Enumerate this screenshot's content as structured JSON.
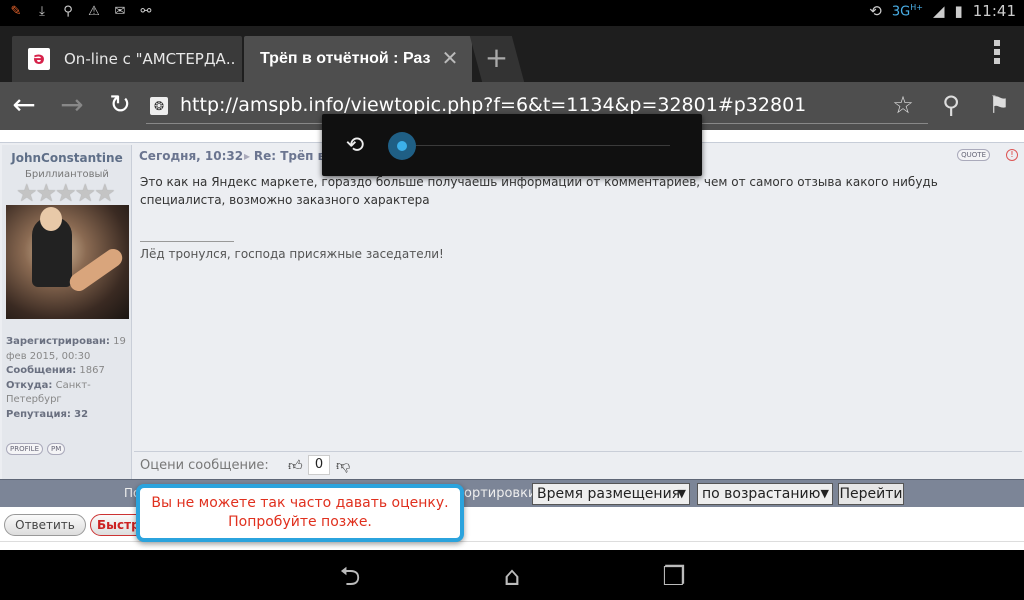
{
  "statusbar": {
    "time": "11:41",
    "network": "3G",
    "network_sup": "H+",
    "left_icons": [
      "app-notification-icon",
      "download-icon",
      "search-icon",
      "warning-icon",
      "message-icon",
      "usb-icon"
    ],
    "right_icons": [
      "rotation-icon",
      "signal-icon",
      "battery-icon"
    ]
  },
  "tabs": [
    {
      "title": "On-line с \"АМСТЕРДА...",
      "active": false,
      "favicon": "ə"
    },
    {
      "title": "Трёп в отчётной : Раз...",
      "active": true
    }
  ],
  "urlbar": {
    "url": "http://amspb.info/viewtopic.php?f=6&t=1134&p=32801#p32801"
  },
  "post": {
    "author": "JohnConstantine",
    "rank": "Бриллиантовый",
    "stars": "★★★★★",
    "registered_label": "Зарегистрирован:",
    "registered_value": "19 фев 2015, 00:30",
    "messages_label": "Сообщения:",
    "messages_value": "1867",
    "from_label": "Откуда:",
    "from_value": "Санкт-Петербург",
    "reputation_label": "Репутация:",
    "reputation_value": "32",
    "profile_btn": "PROFILE",
    "pm_btn": "PM",
    "date": "Сегодня, 10:32",
    "subject": "Re: Трёп в",
    "quote_btn": "QUOTE",
    "body": "Это как на Яндекс маркете, гораздо больше получаешь информации от комментариев, чем от самого отзыва какого нибудь специалиста, возможно заказного характера",
    "signature": "Лёд тронулся, господа присяжные заседатели!",
    "rate_label": "Оцени сообщение:",
    "rate_value": "0"
  },
  "sortbar": {
    "left_text": "По",
    "label": "ортировки",
    "field_value": "Время размещения",
    "dir_value": "по возрастанию",
    "go_label": "Перейти"
  },
  "reply": {
    "reply_label": "Ответить",
    "quick_label": "Быстры"
  },
  "toast": {
    "line1": "Вы не можете так часто давать оценку.",
    "line2": "Попробуйте позже."
  },
  "rotation_panel": {
    "level": 0.0
  }
}
